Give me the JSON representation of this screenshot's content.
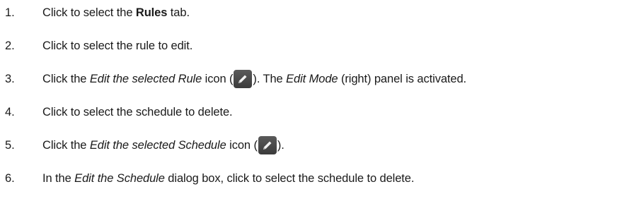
{
  "steps": [
    {
      "num": "1.",
      "parts": [
        "Click to select the ",
        "Rules",
        " tab."
      ]
    },
    {
      "num": "2.",
      "parts": [
        "Click to select the rule to edit."
      ]
    },
    {
      "num": "3.",
      "parts": [
        "Click the ",
        "Edit the selected Rule",
        " icon (",
        "). The ",
        "Edit Mode",
        " (right) panel is activated."
      ]
    },
    {
      "num": "4.",
      "parts": [
        "Click to select the schedule to delete."
      ]
    },
    {
      "num": "5.",
      "parts": [
        "Click the ",
        "Edit the selected Schedule",
        " icon (",
        ")."
      ]
    },
    {
      "num": "6.",
      "parts": [
        "In the ",
        "Edit the Schedule",
        " dialog box, click to select the schedule to delete."
      ]
    }
  ],
  "icons": {
    "pencil": "pencil-edit-icon",
    "pencil_bg": "#4a4a4a"
  }
}
